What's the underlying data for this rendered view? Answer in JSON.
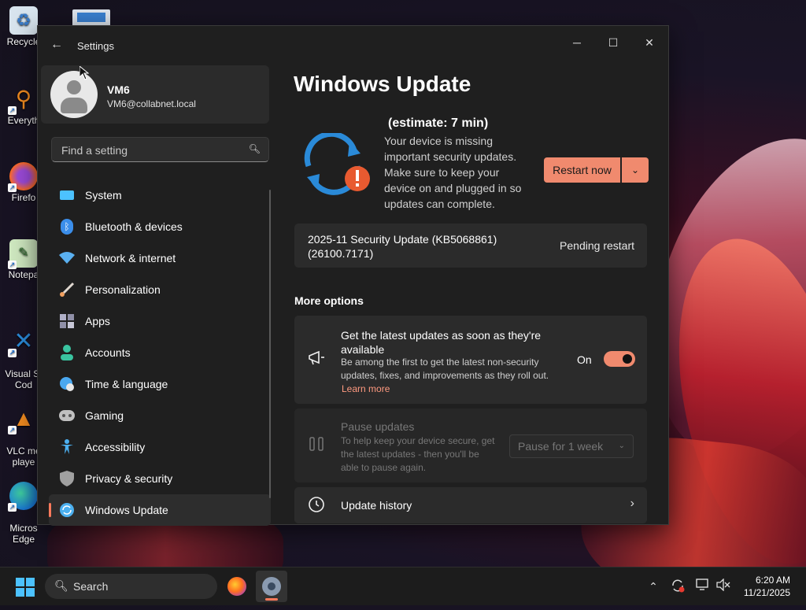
{
  "desktop": {
    "icons": [
      {
        "label": "Recycle",
        "icon": "recycle-bin-icon"
      },
      {
        "label": "Everyth",
        "icon": "everything-icon"
      },
      {
        "label": "Firefo",
        "icon": "firefox-icon"
      },
      {
        "label": "Notepa",
        "icon": "notepad-icon"
      },
      {
        "label": "Visual St\nCod",
        "icon": "vscode-icon"
      },
      {
        "label": "VLC me\nplaye",
        "icon": "vlc-icon"
      },
      {
        "label": "Micros\nEdge",
        "icon": "edge-icon"
      }
    ]
  },
  "window": {
    "title": "Settings",
    "controls": {
      "minimize": "─",
      "maximize": "☐",
      "close": "✕"
    }
  },
  "profile": {
    "name": "VM6",
    "email": "VM6@collabnet.local"
  },
  "search": {
    "placeholder": "Find a setting"
  },
  "nav": {
    "items": [
      {
        "label": "System",
        "icon": "system-icon",
        "color": "#4cc2ff"
      },
      {
        "label": "Bluetooth & devices",
        "icon": "bluetooth-icon",
        "color": "#3b8eea"
      },
      {
        "label": "Network & internet",
        "icon": "wifi-icon",
        "color": "#5ab0f0"
      },
      {
        "label": "Personalization",
        "icon": "brush-icon",
        "color": "#f0a060"
      },
      {
        "label": "Apps",
        "icon": "apps-icon",
        "color": "#b0b0c8"
      },
      {
        "label": "Accounts",
        "icon": "accounts-icon",
        "color": "#3ac4a0"
      },
      {
        "label": "Time & language",
        "icon": "globe-clock-icon",
        "color": "#4aa8f0"
      },
      {
        "label": "Gaming",
        "icon": "gamepad-icon",
        "color": "#c0c0c0"
      },
      {
        "label": "Accessibility",
        "icon": "accessibility-icon",
        "color": "#4cb0f0"
      },
      {
        "label": "Privacy & security",
        "icon": "shield-icon",
        "color": "#a0a0a0"
      },
      {
        "label": "Windows Update",
        "icon": "windows-update-icon",
        "color": "#4cb0f0",
        "active": true
      }
    ]
  },
  "main": {
    "title": "Windows Update",
    "estimate": "(estimate: 7 min)",
    "description": "Your device is missing important security updates. Make sure to keep your device on and plugged in so updates can complete.",
    "restart_label": "Restart now",
    "update": {
      "name": "2025-11 Security Update (KB5068861) (26100.7171)",
      "status": "Pending restart"
    },
    "more_options_label": "More options",
    "options": {
      "latest": {
        "title": "Get the latest updates as soon as they're available",
        "desc": "Be among the first to get the latest non-security updates, fixes, and improvements as they roll out.",
        "learn_more": "Learn more",
        "toggle_label": "On",
        "toggle_on": true
      },
      "pause": {
        "title": "Pause updates",
        "desc": "To help keep your device secure, get the latest updates - then you'll be able to pause again.",
        "select_value": "Pause for 1 week"
      },
      "history": {
        "title": "Update history"
      }
    }
  },
  "taskbar": {
    "search_label": "Search",
    "time": "6:20 AM",
    "date": "11/21/2025"
  },
  "colors": {
    "accent": "#f08a6e",
    "window_bg": "#1f1f1f",
    "card_bg": "#2b2b2b"
  }
}
